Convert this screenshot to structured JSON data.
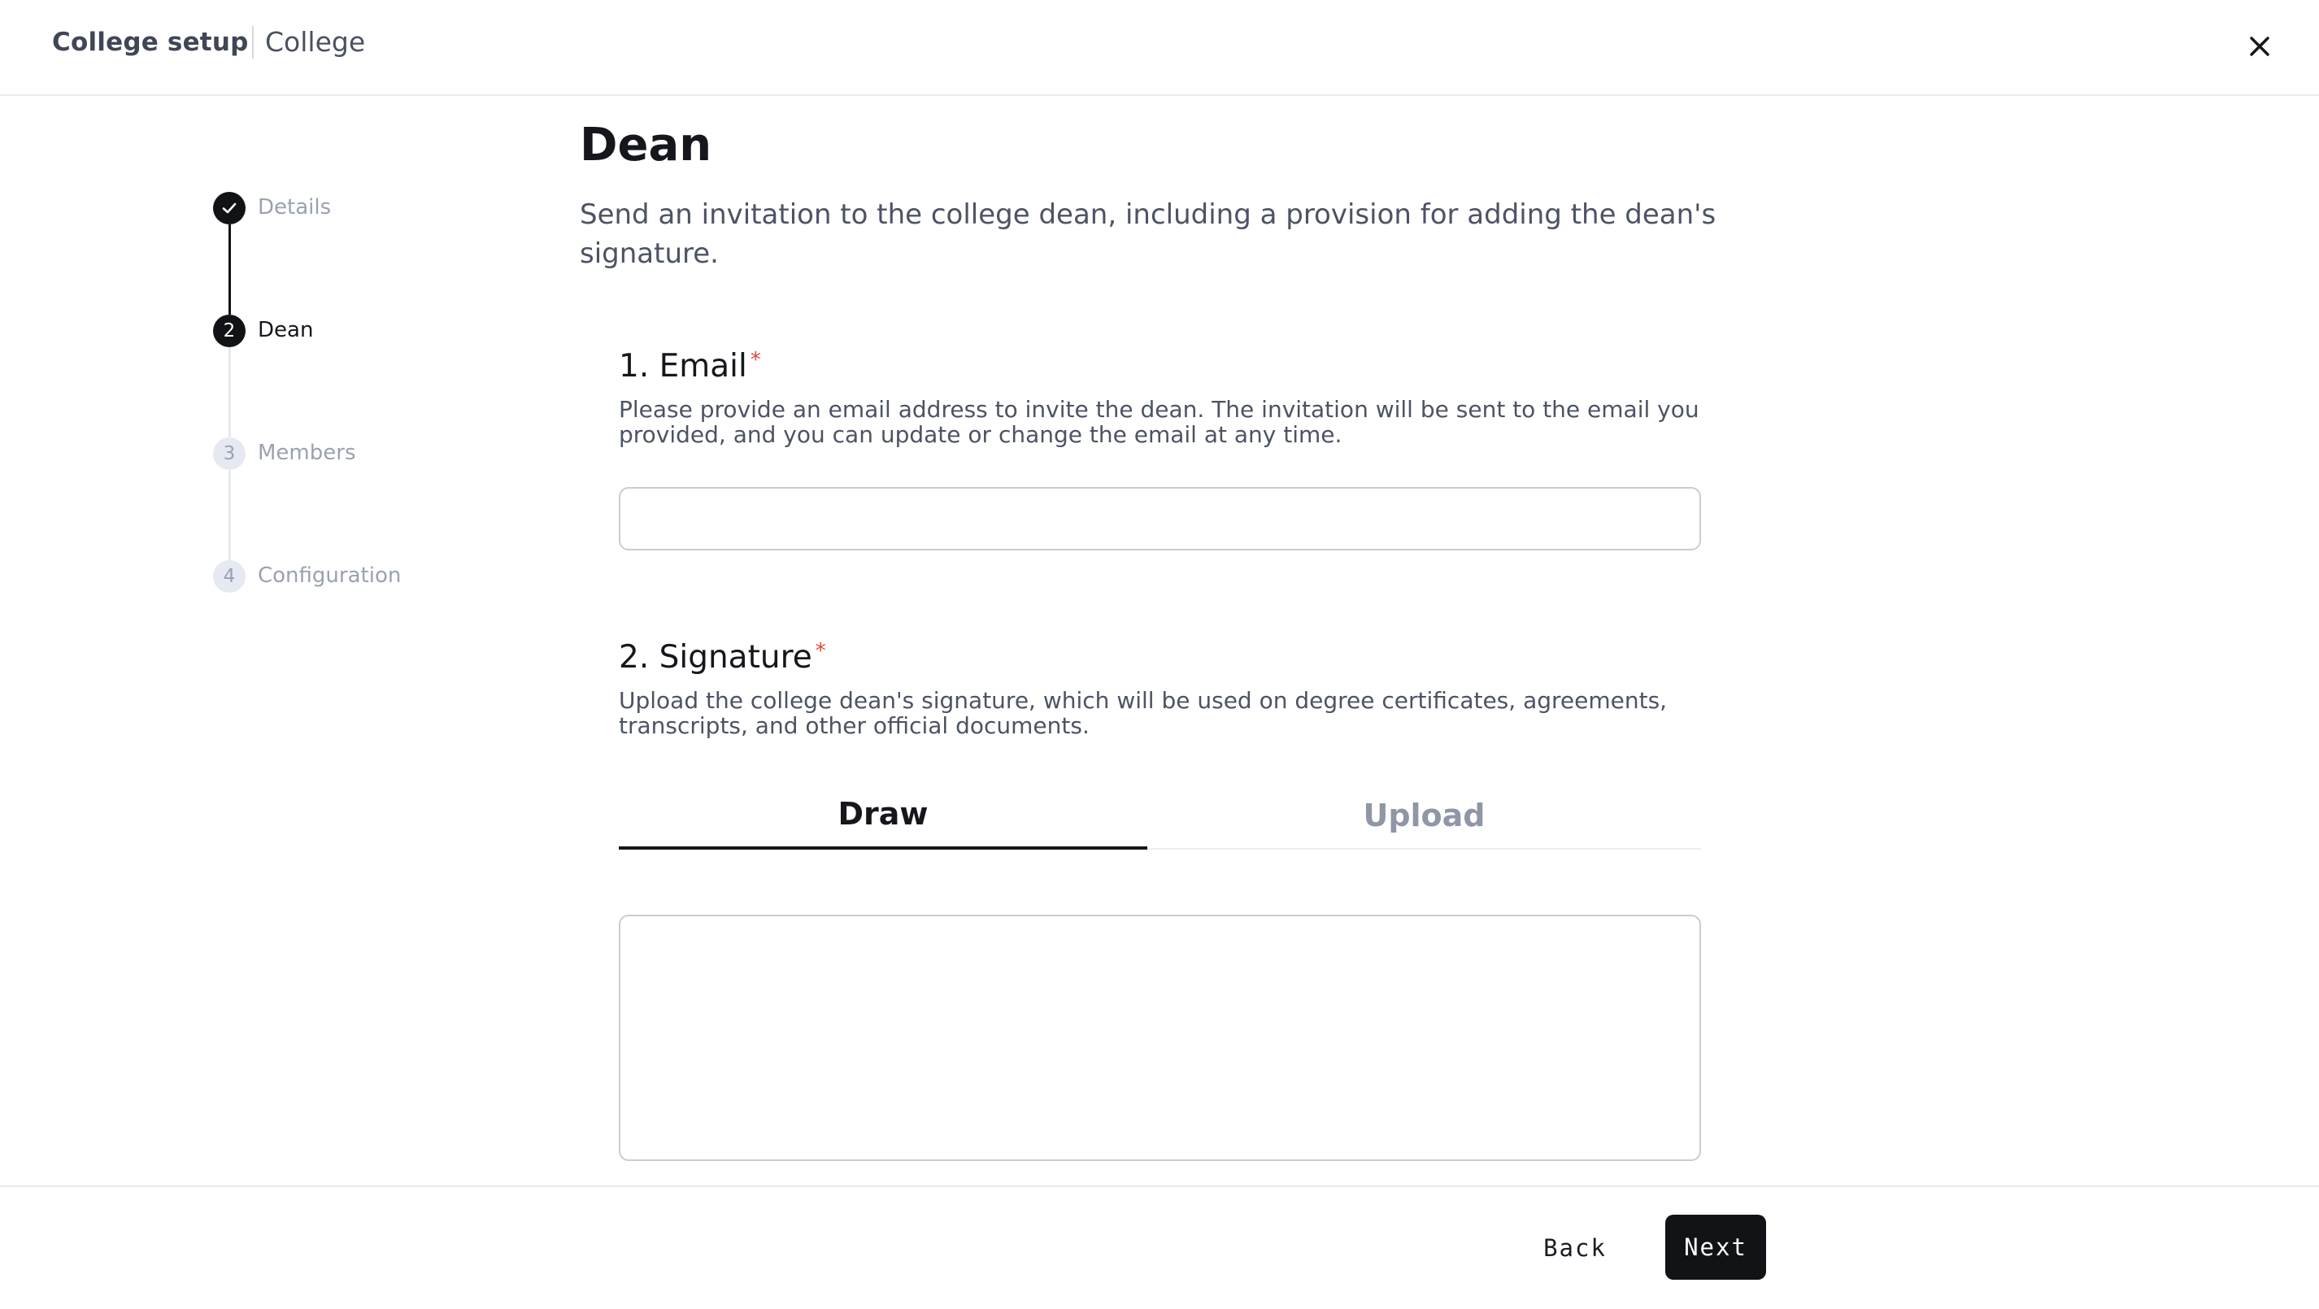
{
  "header": {
    "title": "College setup",
    "subtitle": "College",
    "close_icon": "close-icon"
  },
  "stepper": {
    "steps": [
      {
        "number": "1",
        "label": "Details",
        "state": "done",
        "icon": "check-icon"
      },
      {
        "number": "2",
        "label": "Dean",
        "state": "active"
      },
      {
        "number": "3",
        "label": "Members",
        "state": "pending"
      },
      {
        "number": "4",
        "label": "Configuration",
        "state": "pending"
      }
    ]
  },
  "main": {
    "title": "Dean",
    "description": "Send an invitation to the college dean, including a provision for adding the dean's signature."
  },
  "email_section": {
    "title": "1. Email",
    "required_mark": "*",
    "description": "Please provide an email address to invite the dean. The invitation will be sent to the email you provided, and you can update or change the email at any time.",
    "value": "",
    "placeholder": ""
  },
  "signature_section": {
    "title": "2. Signature",
    "required_mark": "*",
    "description": "Upload the college dean's signature, which will be used on degree certificates, agreements, transcripts, and other official documents.",
    "tabs": [
      {
        "label": "Draw",
        "active": true
      },
      {
        "label": "Upload",
        "active": false
      }
    ]
  },
  "footer": {
    "back_label": "Back",
    "next_label": "Next"
  },
  "colors": {
    "accent": "#111316",
    "required": "#e0483e",
    "muted_text": "#9aa1b1"
  }
}
